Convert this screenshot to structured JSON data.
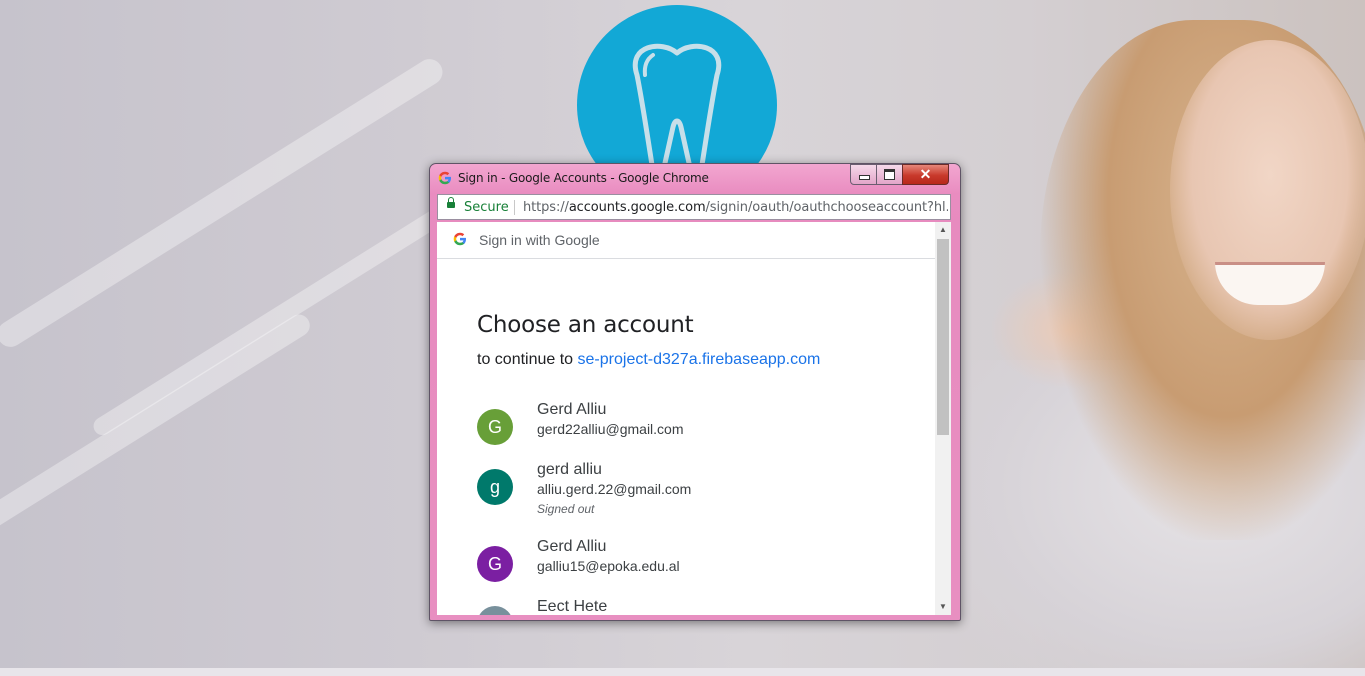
{
  "window": {
    "title": "Sign in - Google Accounts - Google Chrome",
    "close_glyph": "✕"
  },
  "addressbar": {
    "security_label": "Secure",
    "url_scheme": "https://",
    "url_host": "accounts.google.com",
    "url_path": "/signin/oauth/oauthchooseaccount?hl..."
  },
  "google_header": {
    "label": "Sign in with Google"
  },
  "chooser": {
    "heading": "Choose an account",
    "continue_prefix": "to continue to",
    "continue_target": "se-project-d327a.firebaseapp.com"
  },
  "accounts": [
    {
      "initial": "G",
      "name": "Gerd Alliu",
      "email": "gerd22alliu@gmail.com",
      "status": "",
      "color": "#689f38"
    },
    {
      "initial": "g",
      "name": "gerd alliu",
      "email": "alliu.gerd.22@gmail.com",
      "status": "Signed out",
      "color": "#00796b"
    },
    {
      "initial": "G",
      "name": "Gerd Alliu",
      "email": "galliu15@epoka.edu.al",
      "status": "",
      "color": "#7b1fa2"
    },
    {
      "initial": "",
      "name": "Eect Hete",
      "email": "",
      "status": "",
      "color": "#78909c"
    }
  ],
  "colors": {
    "logo_circle": "#12a8d6",
    "link": "#1a73e8",
    "secure_green": "#188038",
    "frame_pink": "#e88fc1"
  }
}
